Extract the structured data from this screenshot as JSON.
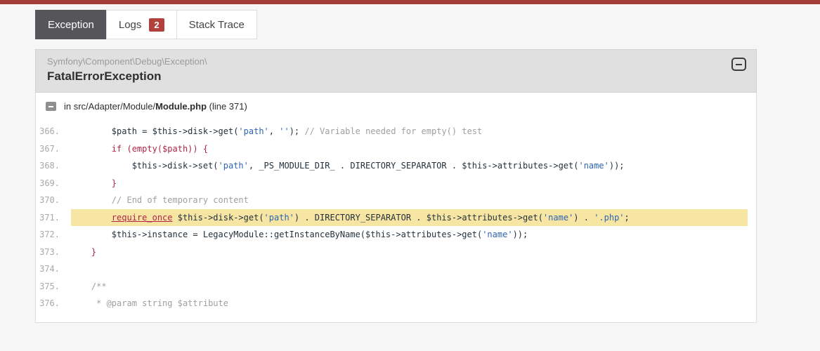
{
  "colors": {
    "topbar": "#a33d38",
    "badge": "#b0413e",
    "active_tab": "#56565a",
    "line_highlight": "#f7e5a4",
    "token_keyword": "#b02449",
    "token_string": "#2e64b1",
    "token_comment": "#9f9f9f"
  },
  "tabs": [
    {
      "label": "Exception",
      "active": true
    },
    {
      "label": "Logs",
      "badge": "2",
      "active": false
    },
    {
      "label": "Stack Trace",
      "active": false
    }
  ],
  "exception": {
    "namespace": "Symfony\\Component\\Debug\\Exception\\",
    "name": "FatalErrorException"
  },
  "file": {
    "location_prefix": "in src/Adapter/Module/",
    "location_file": "Module.php",
    "location_suffix": " (line 371)"
  },
  "code": {
    "lines": [
      {
        "number": "366.",
        "highlighted": false,
        "segments": [
          {
            "type": "d",
            "text": "        $path = $this->disk->get("
          },
          {
            "type": "s",
            "text": "'path'"
          },
          {
            "type": "d",
            "text": ", "
          },
          {
            "type": "s",
            "text": "''"
          },
          {
            "type": "d",
            "text": "); "
          },
          {
            "type": "c",
            "text": "// Variable needed for empty() test"
          }
        ]
      },
      {
        "number": "367.",
        "highlighted": false,
        "segments": [
          {
            "type": "d",
            "text": "        "
          },
          {
            "type": "k",
            "text": "if (empty($path)) {"
          }
        ]
      },
      {
        "number": "368.",
        "highlighted": false,
        "segments": [
          {
            "type": "d",
            "text": "            $this->disk->set("
          },
          {
            "type": "s",
            "text": "'path'"
          },
          {
            "type": "d",
            "text": ", _PS_MODULE_DIR_ . DIRECTORY_SEPARATOR . $this->attributes->get("
          },
          {
            "type": "s",
            "text": "'name'"
          },
          {
            "type": "d",
            "text": "));"
          }
        ]
      },
      {
        "number": "369.",
        "highlighted": false,
        "segments": [
          {
            "type": "d",
            "text": "        "
          },
          {
            "type": "k",
            "text": "}"
          }
        ]
      },
      {
        "number": "370.",
        "highlighted": false,
        "segments": [
          {
            "type": "d",
            "text": "        "
          },
          {
            "type": "c",
            "text": "// End of temporary content"
          }
        ]
      },
      {
        "number": "371.",
        "highlighted": true,
        "segments": [
          {
            "type": "d",
            "text": "        "
          },
          {
            "type": "ku",
            "text": "require_once"
          },
          {
            "type": "d",
            "text": " $this->disk->get("
          },
          {
            "type": "s",
            "text": "'path'"
          },
          {
            "type": "d",
            "text": ") . DIRECTORY_SEPARATOR . $this->attributes->get("
          },
          {
            "type": "s",
            "text": "'name'"
          },
          {
            "type": "d",
            "text": ") . "
          },
          {
            "type": "s",
            "text": "'.php'"
          },
          {
            "type": "d",
            "text": ";"
          }
        ]
      },
      {
        "number": "372.",
        "highlighted": false,
        "segments": [
          {
            "type": "d",
            "text": "        $this->instance = LegacyModule::getInstanceByName($this->attributes->get("
          },
          {
            "type": "s",
            "text": "'name'"
          },
          {
            "type": "d",
            "text": "));"
          }
        ]
      },
      {
        "number": "373.",
        "highlighted": false,
        "segments": [
          {
            "type": "d",
            "text": "    "
          },
          {
            "type": "k",
            "text": "}"
          }
        ]
      },
      {
        "number": "374.",
        "highlighted": false,
        "segments": []
      },
      {
        "number": "375.",
        "highlighted": false,
        "segments": [
          {
            "type": "d",
            "text": "    "
          },
          {
            "type": "c",
            "text": "/**"
          }
        ]
      },
      {
        "number": "376.",
        "highlighted": false,
        "segments": [
          {
            "type": "d",
            "text": "    "
          },
          {
            "type": "c",
            "text": " * @param string $attribute"
          }
        ]
      }
    ]
  }
}
